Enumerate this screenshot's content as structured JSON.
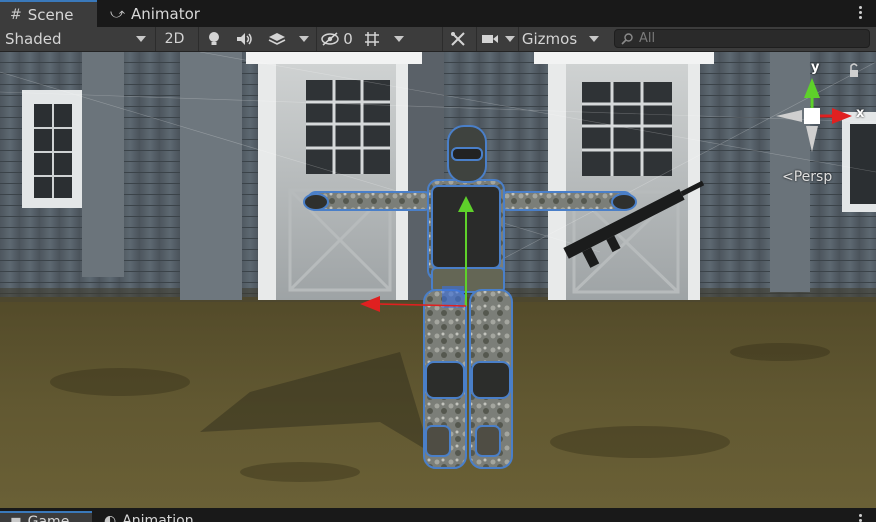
{
  "tabs": [
    {
      "label": "Scene",
      "icon": "grid-icon",
      "active": true
    },
    {
      "label": "Animator",
      "icon": "animator-icon",
      "active": false
    }
  ],
  "toolbar": {
    "shading_mode": "Shaded",
    "mode_2d": "2D",
    "hidden_count": "0",
    "gizmos_label": "Gizmos",
    "search_placeholder": "All"
  },
  "scene": {
    "persp_label": "Persp",
    "axis_y": "y",
    "axis_x": "x"
  },
  "bottom_tabs": [
    {
      "label": "Game",
      "icon": "game-icon",
      "active": true
    },
    {
      "label": "Animation",
      "icon": "animation-icon",
      "active": false
    }
  ],
  "colors": {
    "accent": "#3a79bb",
    "axis_x": "#e02020",
    "axis_y": "#5ed12a",
    "selection_outline": "#4a7fc8"
  }
}
